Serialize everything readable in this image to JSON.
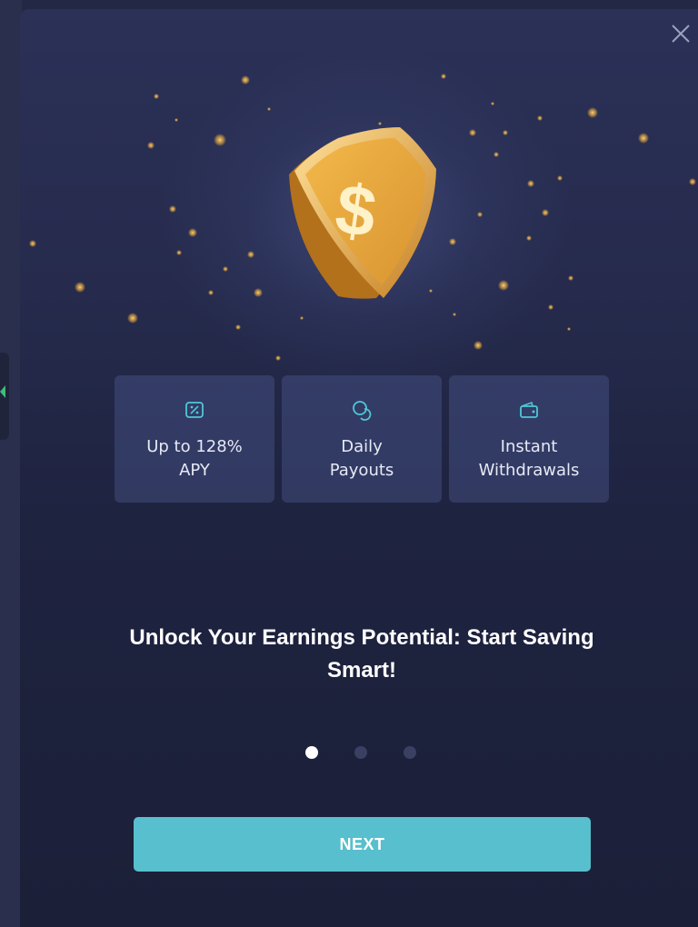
{
  "modal": {
    "close_icon": "close-icon",
    "hero_icon": "dollar-shield-icon"
  },
  "features": [
    {
      "icon": "percent-badge-icon",
      "label": "Up to 128%\nAPY"
    },
    {
      "icon": "coins-icon",
      "label": "Daily\nPayouts"
    },
    {
      "icon": "wallet-icon",
      "label": "Instant\nWithdrawals"
    }
  ],
  "headline": "Unlock Your Earnings Potential: Start Saving Smart!",
  "pagination": {
    "current": 1,
    "total": 3
  },
  "next_button": {
    "label": "NEXT"
  },
  "colors": {
    "background": "#232844",
    "accent": "#57bfcd",
    "gold": "#e8a93a",
    "card": "#3a4478"
  }
}
